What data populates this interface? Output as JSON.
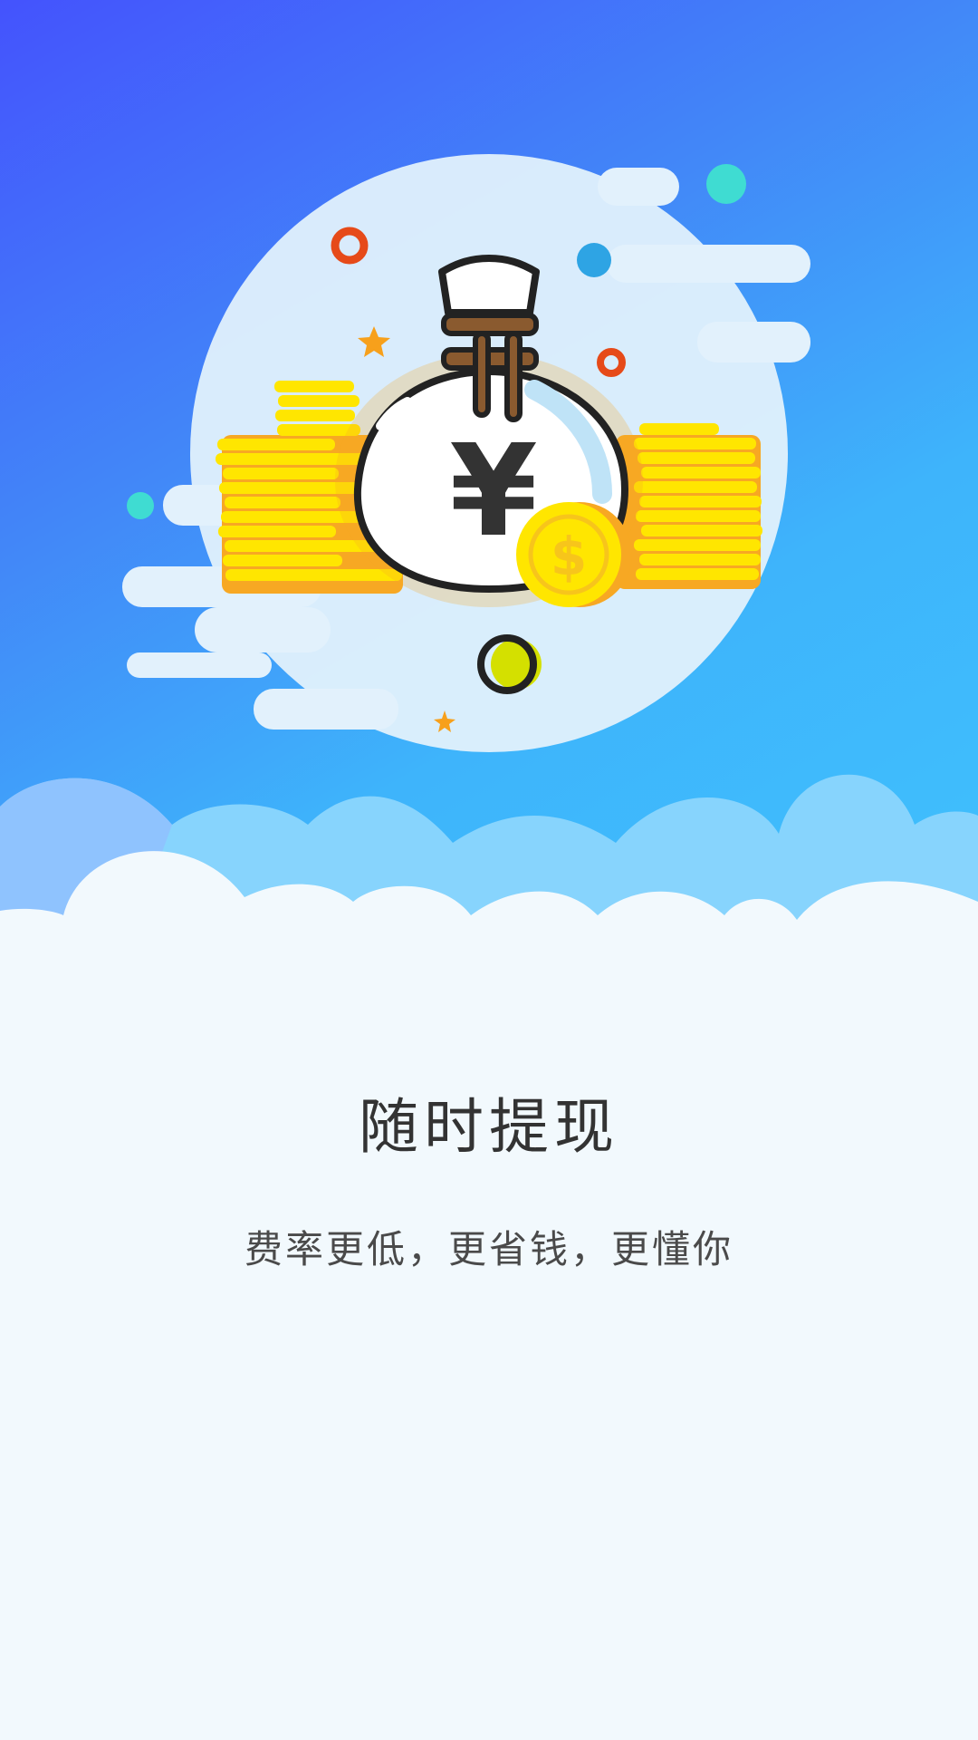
{
  "splash": {
    "title": "随时提现",
    "subtitle": "费率更低，更省钱，更懂你"
  },
  "illustration": {
    "bag_symbol": "¥",
    "coin_symbol": "$",
    "icon": "money-bag-icon"
  },
  "colors": {
    "sky_top": "#4453fd",
    "sky_bottom": "#40c2fd",
    "ground": "#f2f9fd",
    "coin": "#ffe600",
    "coin_shadow": "#f7a823",
    "bag_tie": "#8a5a2f",
    "title_text": "#333333"
  }
}
